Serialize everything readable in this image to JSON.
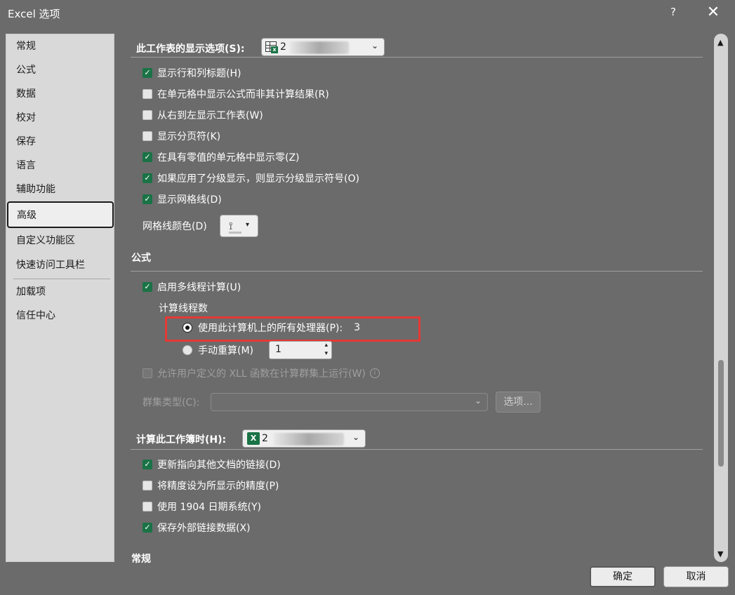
{
  "window": {
    "title": "Excel 选项",
    "help": "?",
    "close": "✕"
  },
  "nav": {
    "items": [
      {
        "label": "常规"
      },
      {
        "label": "公式"
      },
      {
        "label": "数据"
      },
      {
        "label": "校对"
      },
      {
        "label": "保存"
      },
      {
        "label": "语言"
      },
      {
        "label": "辅助功能"
      },
      {
        "label": "高级",
        "selected": true
      },
      {
        "label": "自定义功能区"
      },
      {
        "label": "快速访问工具栏"
      },
      {
        "label": "加载项"
      },
      {
        "label": "信任中心"
      }
    ]
  },
  "worksheet_display": {
    "heading": "此工作表的显示选项(S):",
    "combo_text": "2",
    "options": [
      {
        "label": "显示行和列标题(H)",
        "checked": true
      },
      {
        "label": "在单元格中显示公式而非其计算结果(R)",
        "checked": false
      },
      {
        "label": "从右到左显示工作表(W)",
        "checked": false
      },
      {
        "label": "显示分页符(K)",
        "checked": false
      },
      {
        "label": "在具有零值的单元格中显示零(Z)",
        "checked": true
      },
      {
        "label": "如果应用了分级显示，则显示分级显示符号(O)",
        "checked": true
      },
      {
        "label": "显示网格线(D)",
        "checked": true
      }
    ],
    "gridline_color_label": "网格线颜色(D)"
  },
  "formulas": {
    "heading": "公式",
    "multithread": {
      "label": "启用多线程计算(U)",
      "checked": true
    },
    "threads_label": "计算线程数",
    "use_all": {
      "label": "使用此计算机上的所有处理器(P):",
      "value": "3",
      "selected": true
    },
    "manual": {
      "label": "手动重算(M)",
      "value": "1",
      "selected": false
    },
    "xll": {
      "label": "允许用户定义的 XLL 函数在计算群集上运行(W)",
      "checked": false,
      "disabled": true
    },
    "cluster_type_label": "群集类型(C):",
    "options_button": "选项..."
  },
  "workbook_calc": {
    "heading": "计算此工作簿时(H):",
    "combo_text": "2",
    "options": [
      {
        "label": "更新指向其他文档的链接(D)",
        "checked": true
      },
      {
        "label": "将精度设为所显示的精度(P)",
        "checked": false
      },
      {
        "label": "使用 1904 日期系统(Y)",
        "checked": false
      },
      {
        "label": "保存外部链接数据(X)",
        "checked": true
      }
    ]
  },
  "general_heading": "常规",
  "buttons": {
    "ok": "确定",
    "cancel": "取消"
  },
  "colors": {
    "accent_green": "#1a7346",
    "highlight_red": "#e53935",
    "dialog_bg": "#6b6b6b"
  },
  "icons": {
    "check": "✓",
    "chevron_down": "⌄",
    "dropdown_arrow": "▾",
    "scroll_up": "▲",
    "scroll_down": "▼",
    "spin_up": "▴",
    "spin_down": "▾",
    "info": "i",
    "paint_bucket": "⟟"
  }
}
